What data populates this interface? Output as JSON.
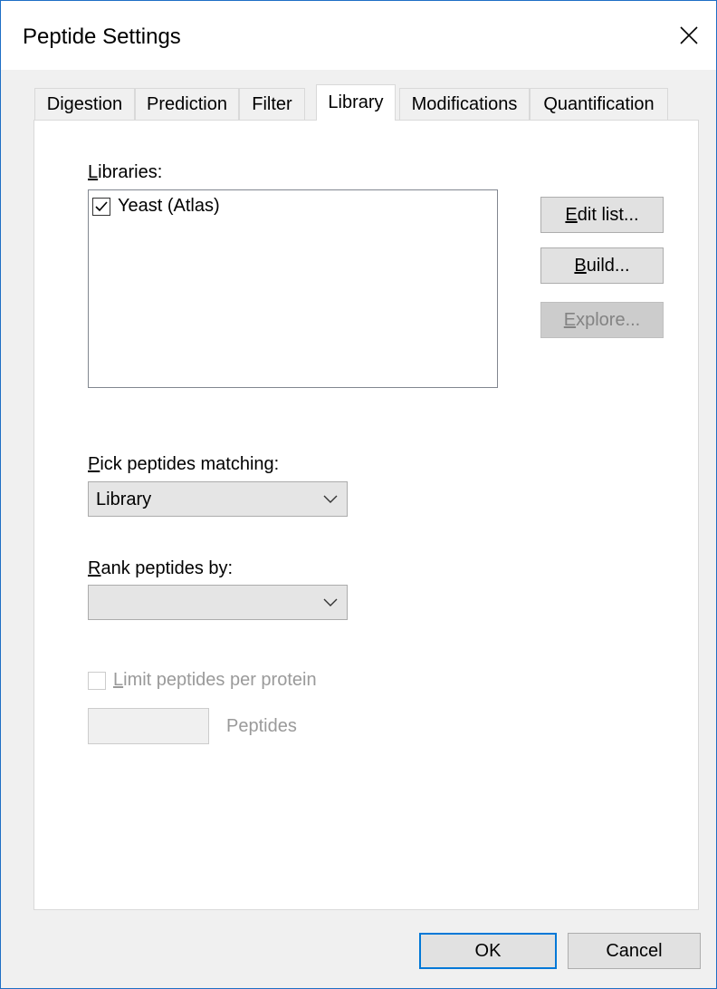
{
  "window": {
    "title": "Peptide Settings"
  },
  "tabs": [
    {
      "label": "Digestion"
    },
    {
      "label": "Prediction"
    },
    {
      "label": "Filter"
    },
    {
      "label": "Library"
    },
    {
      "label": "Modifications"
    },
    {
      "label": "Quantification"
    }
  ],
  "active_tab": "Library",
  "libraries": {
    "label_mnemonic": "L",
    "label_rest": "ibraries:",
    "items": [
      {
        "name": "Yeast (Atlas)",
        "checked": true
      }
    ]
  },
  "side_buttons": {
    "edit_list": {
      "mnemonic": "E",
      "rest": "dit list..."
    },
    "build": {
      "mnemonic": "B",
      "rest": "uild..."
    },
    "explore": {
      "mnemonic": "E",
      "rest": "xplore...",
      "enabled": false
    }
  },
  "pick": {
    "label_mnemonic": "P",
    "label_rest": "ick peptides matching:",
    "value": "Library"
  },
  "rank": {
    "label_mnemonic": "R",
    "label_rest": "ank peptides by:",
    "value": ""
  },
  "limit": {
    "label_mnemonic": "L",
    "label_rest": "imit peptides per protein",
    "checked": false,
    "enabled": false,
    "value": "",
    "unit": "Peptides"
  },
  "footer": {
    "ok": "OK",
    "cancel": "Cancel"
  },
  "colors": {
    "accent": "#0078d7",
    "border": "#1e6fc5"
  }
}
